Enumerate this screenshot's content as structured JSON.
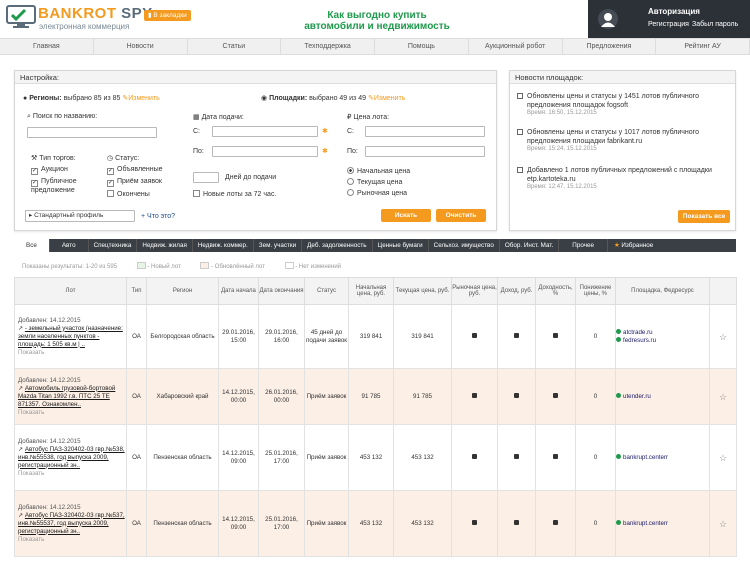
{
  "header": {
    "brand_a": "BANKROT",
    "brand_b": "SPY",
    "brand_sub": "электронная коммерция",
    "fav_label": "В закладки",
    "slogan_1": "Как выгодно купить",
    "slogan_2": "автомобили и недвижимость"
  },
  "auth": {
    "title": "Авторизация",
    "register": "Регистрация",
    "forgot": "Забыл пароль"
  },
  "nav": [
    "Главная",
    "Новости",
    "Статьи",
    "Техподдержка",
    "Помощь",
    "Аукционный робот",
    "Предложения",
    "Рейтинг АУ"
  ],
  "settings": {
    "title": "Настройка:",
    "regions_label": "Регионы:",
    "regions_value": "выбрано 85 из 85",
    "regions_edit": "Изменить",
    "platforms_label": "Площадки:",
    "platforms_value": "выбрано 49 из 49",
    "platforms_edit": "Изменить",
    "search_label": "Поиск по названию:",
    "date_label": "Дата подачи:",
    "date_from": "С:",
    "date_to": "По:",
    "price_label": "Цена лота:",
    "price_from": "С:",
    "price_to": "По:",
    "type_label": "Тип торгов:",
    "type_options": [
      "Аукцион",
      "Публичное предложение"
    ],
    "status_label": "Статус:",
    "status_options": [
      "Объявленные",
      "Приём заявок",
      "Окончены"
    ],
    "days_label": "Дней до подачи",
    "new_lots": "Новые лоты за 72 час.",
    "price_options": [
      "Начальная цена",
      "Текущая цена",
      "Рыночная цена"
    ],
    "profile": "Стандартный профиль",
    "what": "Что это?",
    "search_btn": "Искать",
    "clear_btn": "Очистить"
  },
  "news": {
    "title": "Новости площадок:",
    "items": [
      {
        "text": "Обновлены цены и статусы у 1451 лотов публичного предложения площадок fogsoft",
        "time": "Время: 16:50, 15.12.2015"
      },
      {
        "text": "Обновлены цены и статусы у 1017 лотов публичного предложения площадки fabrikant.ru",
        "time": "Время: 15:24, 15.12.2015"
      },
      {
        "text": "Добавлено 1 лотов публичных предложений с площадки etp.kartoteka.ru",
        "time": "Время: 12:47, 15.12.2015"
      }
    ],
    "show_all": "Показать все"
  },
  "tabs": [
    "Все",
    "Авто",
    "Спецтехника",
    "Недвиж. жилая",
    "Недвиж. коммер.",
    "Зем. участки",
    "Деб. задолженность",
    "Ценные бумаги",
    "Сельхоз. имущество",
    "Обор. Инст. Мат.",
    "Прочее",
    "Избранное"
  ],
  "legend": {
    "shown": "Показаны результаты: 1-20 из 595",
    "new": "- Новый лот",
    "updated": "- Обновлённый лот",
    "nochange": "- Нет изменений"
  },
  "table": {
    "headers": [
      "Лот",
      "Тип",
      "Регион",
      "Дата начала",
      "Дата окончания",
      "Статус",
      "Начальная цена, руб.",
      "Текущая цена, руб.",
      "Рыночная цена, руб.",
      "Доход, руб.",
      "Доходность, %",
      "Понижение цены, %",
      "Площадка, Федресурс",
      ""
    ],
    "rows": [
      {
        "added": "Добавлен: 14.12.2015",
        "title": "- земельный участок (назначение: земли населенных пунктов - площадь: 1 505 кв.м | ..",
        "show": "Показать",
        "type": "ОА",
        "region": "Белгородская область",
        "start": "29.01.2016, 15:00",
        "end": "29.01.2016, 16:00",
        "status": "45 дней до подачи заявок",
        "p1": "319 841",
        "p2": "319 841",
        "drop": "0",
        "sites": [
          "atctrade.ru",
          "fedresurs.ru"
        ]
      },
      {
        "added": "Добавлен: 14.12.2015",
        "title": "Автомобиль грузовой-бортовой Mazda Titan 1992 г.в. ПТС 25 ТЕ 871357. Ознакомлен..",
        "show": "Показать",
        "type": "ОА",
        "region": "Хабаровский край",
        "start": "14.12.2015, 00:00",
        "end": "26.01.2016, 00:00",
        "status": "Приём заявок",
        "p1": "91 785",
        "p2": "91 785",
        "drop": "0",
        "sites": [
          "utender.ru"
        ]
      },
      {
        "added": "Добавлен: 14.12.2015",
        "title": "Автобус ПАЗ-320402-03 гвр.№538, инв.№55538, год выпуска 2009, регистрационный зн..",
        "show": "Показать",
        "type": "ОА",
        "region": "Пензенская область",
        "start": "14.12.2015, 09:00",
        "end": "25.01.2016, 17:00",
        "status": "Приём заявок",
        "p1": "453 132",
        "p2": "453 132",
        "drop": "0",
        "sites": [
          "bankrupt.centerr"
        ]
      },
      {
        "added": "Добавлен: 14.12.2015",
        "title": "Автобус ПАЗ-320402-03 гвр.№537, инв.№55537, год выпуска 2009, регистрационный зн..",
        "show": "Показать",
        "type": "ОА",
        "region": "Пензенская область",
        "start": "14.12.2015, 09:00",
        "end": "25.01.2016, 17:00",
        "status": "Приём заявок",
        "p1": "453 132",
        "p2": "453 132",
        "drop": "0",
        "sites": [
          "bankrupt.centerr"
        ]
      }
    ]
  }
}
